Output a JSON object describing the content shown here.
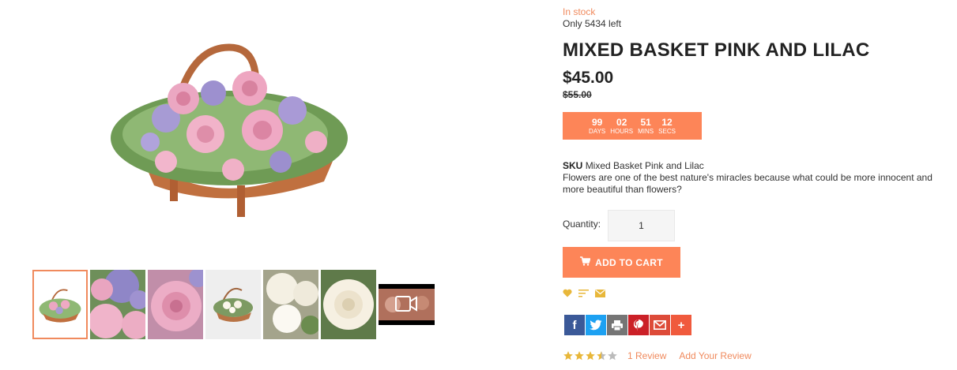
{
  "product": {
    "stock_status": "In stock",
    "stock_left": "Only 5434 left",
    "title": "MIXED BASKET PINK AND LILAC",
    "price": "$45.00",
    "old_price": "$55.00",
    "sku_label": "SKU",
    "sku_value": "Mixed Basket Pink and Lilac",
    "description": "Flowers are one of the best nature's miracles because what could be more innocent and more beautiful than flowers?"
  },
  "countdown": {
    "days": "99",
    "days_label": "DAYS",
    "hours": "02",
    "hours_label": "HOURS",
    "mins": "51",
    "mins_label": "MINS",
    "secs": "12",
    "secs_label": "SECS"
  },
  "quantity": {
    "label": "Quantity:",
    "value": "1"
  },
  "cart": {
    "label": "ADD TO CART",
    "icon": "cart-icon"
  },
  "mini_actions": [
    "wishlist-heart-icon",
    "compare-icon",
    "email-icon"
  ],
  "share": [
    {
      "name": "facebook",
      "glyph": "f",
      "color": "#3b5998"
    },
    {
      "name": "twitter",
      "glyph": "t",
      "color": "#1da1f2"
    },
    {
      "name": "print",
      "glyph": "p",
      "color": "#757575"
    },
    {
      "name": "pinterest",
      "glyph": "P",
      "color": "#cb2027"
    },
    {
      "name": "gmail",
      "glyph": "M",
      "color": "#dd4b39"
    },
    {
      "name": "more",
      "glyph": "+",
      "color": "#f05a3d"
    }
  ],
  "rating": {
    "stars": 3.5,
    "max": 5,
    "reviews_text": "1 Review",
    "add_review_text": "Add Your Review"
  },
  "colors": {
    "accent": "#fd8558",
    "accent_text": "#f08a5d"
  },
  "gallery": {
    "thumbnails": [
      "basket-pink-lilac",
      "lilac-pink-roses-closeup",
      "pink-rose-closeup",
      "white-basket",
      "white-flowers",
      "white-rose",
      "video-thumbnail"
    ],
    "active_index": 0
  }
}
